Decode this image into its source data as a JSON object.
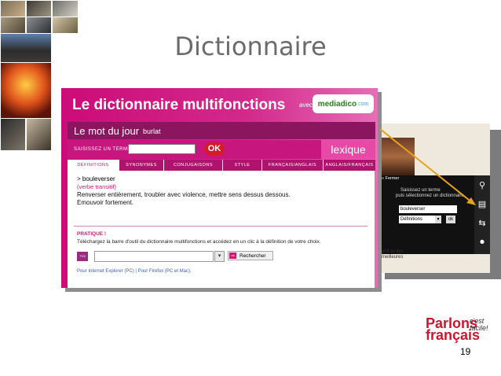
{
  "slide": {
    "title": "Dictionnaire",
    "page_number": "19"
  },
  "app": {
    "title": "Le dictionnaire multifonctions",
    "partner_prefix": "avec",
    "partner_name": "mediadico",
    "partner_suffix": ".com"
  },
  "word_of_day": {
    "label": "Le mot du jour",
    "word": "burlat"
  },
  "search": {
    "label": "SAISISSEZ UN TERME",
    "value": "",
    "button": "OK",
    "lexique_tab": "lexique"
  },
  "tabs": [
    {
      "label": "DÉFINITIONS",
      "active": true
    },
    {
      "label": "SYNONYMES",
      "active": false
    },
    {
      "label": "CONJUGAISONS",
      "active": false
    },
    {
      "label": "STYLE",
      "active": false
    },
    {
      "label": "FRANÇAIS/ANGLAIS",
      "active": false
    },
    {
      "label": "ANGLAIS/FRANÇAIS",
      "active": false
    }
  ],
  "definition": {
    "word": "> bouleverser",
    "type": "(verbe transitif)",
    "line1": "Renverser entièrement, troubler avec violence, mettre sens dessus dessous.",
    "line2": "Emouvoir fortement."
  },
  "pratique": {
    "heading": "PRATIQUE !",
    "text": "Téléchargez la barre d'outil du dictionnaire multifonctions et accédez en un clic à la définition de votre choix.",
    "toolbar_logo": "TV5",
    "toolbar_search": "Rechercher",
    "links": "Pour Internet Explorer (PC)  |  Pour Firefox (PC et Mac)."
  },
  "side_panel": {
    "former": "« Fermer",
    "line1": "Saisissez un terme",
    "line2": "puis sélectionnez un dictionnaire.",
    "input_value": "bouleverser",
    "select_value": "Définitions",
    "ok": "ok",
    "footer1": "unit et des",
    "footer2": "meilleures",
    "icons": [
      "search-icon",
      "book-icon",
      "arrows-icon",
      "microphone-icon"
    ]
  },
  "logo": {
    "line1": "Parlons",
    "line2": "français",
    "tag1": "c'est",
    "tag2": "facile!"
  },
  "colors": {
    "magenta": "#cc0b78",
    "dark_magenta": "#8c1560",
    "red": "#c8182e",
    "arrow": "#e6a21a"
  }
}
